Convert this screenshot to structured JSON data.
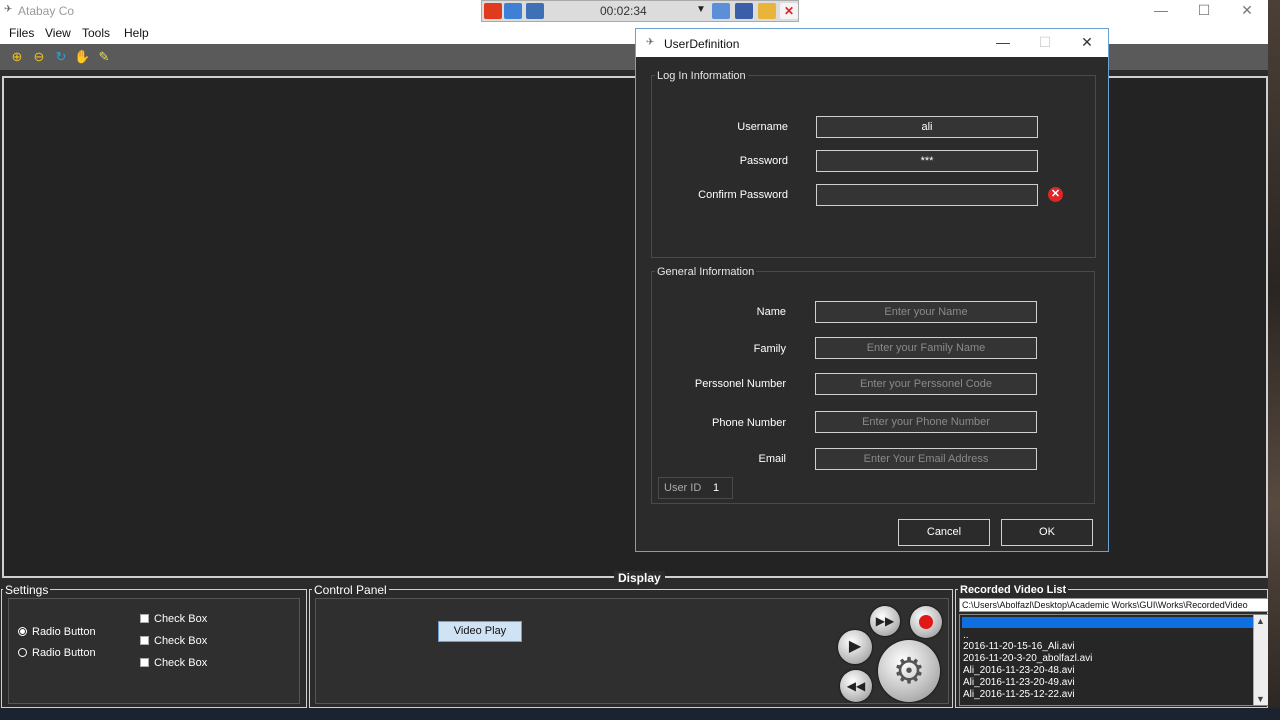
{
  "app": {
    "title": "Atabay Co"
  },
  "recorder": {
    "time": "00:02:34"
  },
  "menubar": {
    "items": [
      "Files",
      "View",
      "Tools",
      "Help"
    ]
  },
  "display": {
    "label": "Display"
  },
  "settings": {
    "label": "Settings",
    "radios": [
      "Radio Button",
      "Radio Button"
    ],
    "checks": [
      "Check Box",
      "Check Box",
      "Check Box"
    ]
  },
  "control_panel": {
    "label": "Control Panel",
    "video_play": "Video Play"
  },
  "video_list": {
    "label": "Recorded Video List",
    "path": "C:\\Users\\Abolfazl\\Desktop\\Academic Works\\GUI\\Works\\RecordedVideo",
    "items": [
      "..",
      "2016-11-20-15-16_Ali.avi",
      "2016-11-20-3-20_abolfazl.avi",
      "Ali_2016-11-23-20-48.avi",
      "Ali_2016-11-23-20-49.avi",
      "Ali_2016-11-25-12-22.avi"
    ]
  },
  "dialog": {
    "title": "UserDefinition",
    "login_group": "Log In Information",
    "username_label": "Username",
    "username_value": "ali",
    "password_label": "Password",
    "password_value": "***",
    "confirm_label": "Confirm Password",
    "confirm_value": "",
    "general_group": "General Information",
    "name_label": "Name",
    "name_placeholder": "Enter your Name",
    "family_label": "Family",
    "family_placeholder": "Enter your Family Name",
    "personnel_label": "Perssonel Number",
    "personnel_placeholder": "Enter your Perssonel Code",
    "phone_label": "Phone Number",
    "phone_placeholder": "Enter your Phone Number",
    "email_label": "Email",
    "email_placeholder": "Enter Your Email Address",
    "userid_label": "User ID",
    "userid_value": "1",
    "cancel": "Cancel",
    "ok": "OK"
  },
  "colors": {
    "accent": "#0f6fe0",
    "error": "#e02525",
    "dialog_border": "#6f9fd4"
  }
}
